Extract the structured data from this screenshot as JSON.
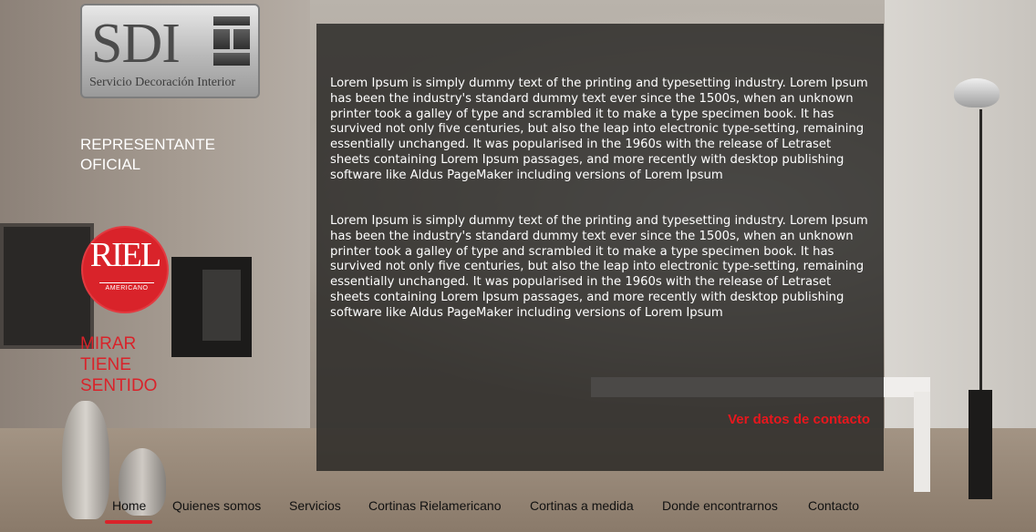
{
  "logo": {
    "text": "SDI",
    "subtitle": "Servicio Decoración Interior"
  },
  "sidebar": {
    "representante": "REPRESENTANTE OFICIAL",
    "riel_logo_name": "RIEL",
    "riel_logo_sub": "AMERICANO",
    "slogan_lines": [
      "MIRAR",
      "TIENE",
      "SENTIDO"
    ]
  },
  "content": {
    "paragraphs": [
      "Lorem Ipsum is simply dummy text of the printing and typesetting industry. Lorem Ipsum has been the industry's standard dummy text ever since the 1500s, when an unknown printer took a galley of type and scrambled it to make a type specimen book. It has survived not only five centuries, but also the leap into electronic type-setting, remaining essentially unchanged. It was popularised in the 1960s with the release of Letraset sheets containing Lorem Ipsum passages, and more recently with desktop publishing software like Aldus PageMaker including versions of Lorem Ipsum",
      "Lorem Ipsum is simply dummy text of the printing and typesetting industry. Lorem Ipsum has been the industry's standard dummy text ever since the 1500s, when an unknown printer took a galley of type and scrambled it to make a type specimen book. It has survived not only five centuries, but also the leap into electronic type-setting, remaining essentially unchanged. It was popularised in the 1960s with the release of Letraset sheets containing Lorem Ipsum passages, and more recently with desktop publishing software like Aldus PageMaker including versions of Lorem Ipsum"
    ],
    "contact_link": "Ver datos de contacto"
  },
  "nav": {
    "items": [
      {
        "label": "Home",
        "active": true
      },
      {
        "label": "Quienes somos"
      },
      {
        "label": "Servicios"
      },
      {
        "label": "Cortinas Rielamericano"
      },
      {
        "label": "Cortinas a medida"
      },
      {
        "label": "Donde encontrarnos"
      },
      {
        "label": "Contacto"
      }
    ]
  },
  "colors": {
    "accent": "#d9232a",
    "link": "#e8171d",
    "panel": "#262422"
  },
  "icons": {
    "logo_mark": "sdi-square-mark-icon"
  }
}
